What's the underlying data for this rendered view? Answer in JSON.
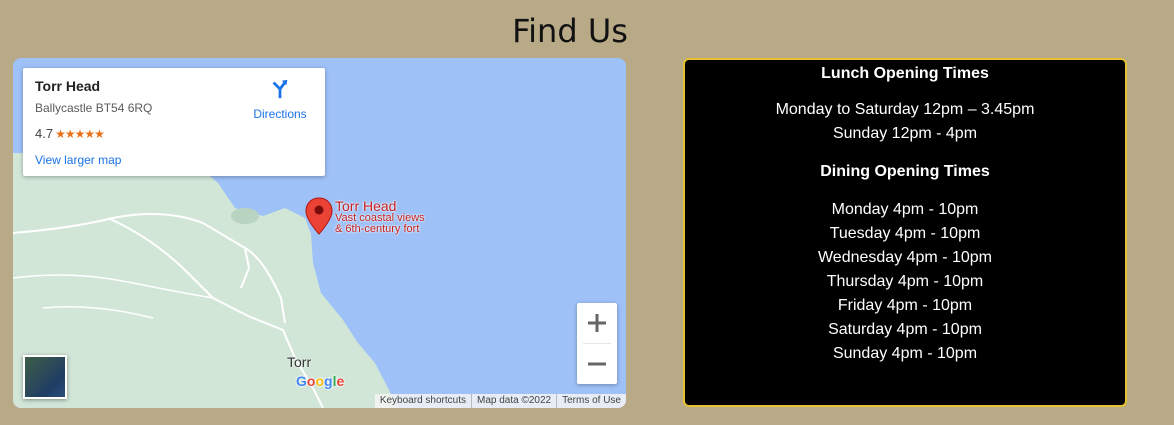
{
  "page": {
    "title": "Find Us"
  },
  "map": {
    "place_name": "Torr Head",
    "address": "Ballycastle BT54 6RQ",
    "rating": "4.7",
    "stars": "★★★★★",
    "view_larger": "View larger map",
    "directions": "Directions",
    "pin_title": "Torr Head",
    "pin_sub1": "Vast coastal views",
    "pin_sub2": "& 6th-century fort",
    "town": "Torr",
    "google": [
      "G",
      "o",
      "o",
      "g",
      "l",
      "e"
    ],
    "attribution": {
      "shortcuts": "Keyboard shortcuts",
      "data": "Map data ©2022",
      "terms": "Terms of Use"
    },
    "colors": {
      "water": "#9ec1f7",
      "land": "#d2e6d8",
      "pin": "#ea4335",
      "link": "#1a73e8"
    }
  },
  "hours": {
    "lunch_heading": "Lunch Opening Times",
    "lunch_lines": [
      "Monday to Saturday 12pm – 3.45pm",
      "Sunday 12pm - 4pm"
    ],
    "dining_heading": "Dining Opening Times",
    "dining_lines": [
      "Monday 4pm - 10pm",
      "Tuesday 4pm - 10pm",
      "Wednesday 4pm - 10pm",
      "Thursday 4pm - 10pm",
      "Friday 4pm - 10pm",
      "Saturday 4pm - 10pm",
      "Sunday 4pm - 10pm"
    ]
  }
}
